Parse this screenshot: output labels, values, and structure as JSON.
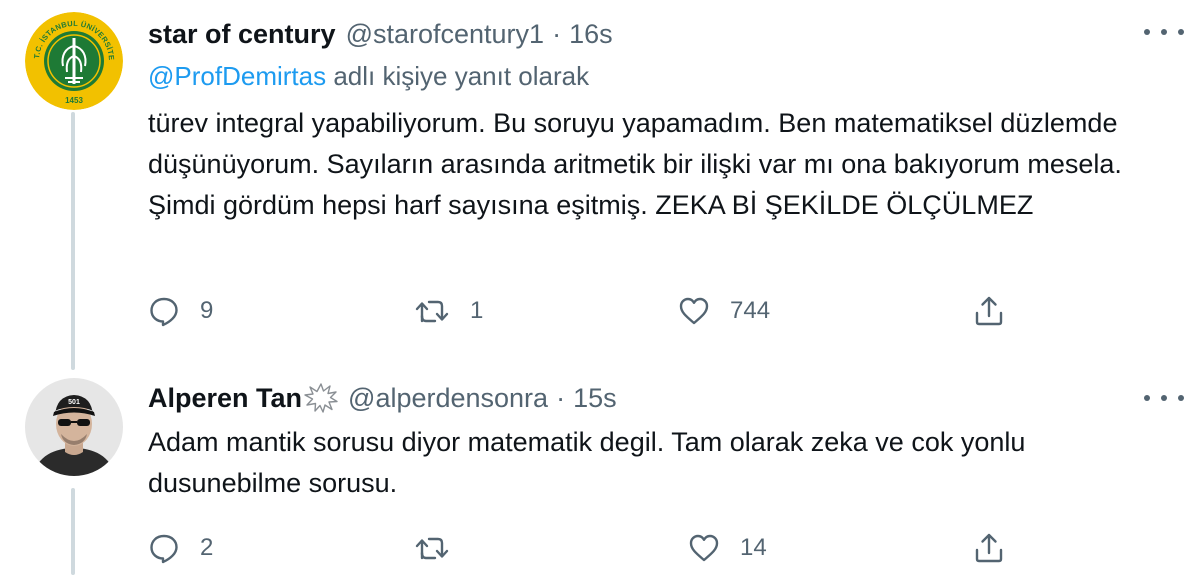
{
  "tweets": [
    {
      "name": "star of century",
      "handle": "@starofcentury1",
      "time": "16s",
      "reply_prefix": "@ProfDemirtas",
      "reply_suffix": " adlı kişiye yanıt olarak",
      "text": "türev integral yapabiliyorum. Bu soruyu yapamadım. Ben matematiksel düzlemde düşünüyorum. Sayıların arasında aritmetik bir ilişki var mı ona bakıyorum mesela. Şimdi gördüm hepsi harf sayısına eşitmiş. ZEKA Bİ ŞEKİLDE ÖLÇÜLMEZ",
      "replies": "9",
      "retweets": "1",
      "likes": "744",
      "avatar_logo_text": "T.C. İSTANBUL ÜNİVERSİTESİ",
      "avatar_logo_year": "1453"
    },
    {
      "name": "Alperen Tan",
      "handle": "@alperdensonra",
      "time": "15s",
      "text": "Adam mantik sorusu diyor matematik degil. Tam olarak zeka ve cok yonlu dusunebilme sorusu.",
      "replies": "2",
      "retweets": "",
      "likes": "14",
      "avatar_cap_text": "501"
    }
  ],
  "separator": "·",
  "colors": {
    "text": "#0f1419",
    "secondary": "#536471",
    "link": "#1d9bf0",
    "thread_line": "#cfd9de",
    "logo_gold": "#f2c100",
    "logo_green": "#1e7a35"
  },
  "icons": [
    "reply-icon",
    "retweet-icon",
    "like-icon",
    "share-icon",
    "more-icon",
    "verified-burst-icon"
  ]
}
